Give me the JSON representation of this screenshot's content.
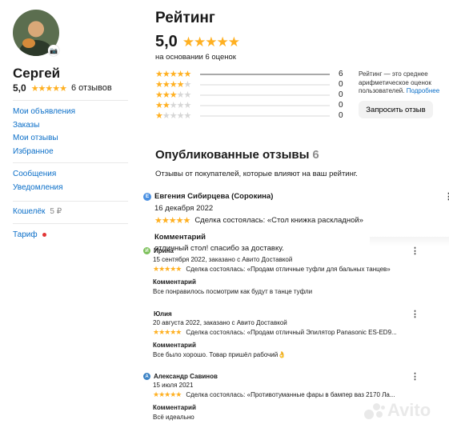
{
  "sidebar": {
    "name": "Сергей",
    "rating": "5,0",
    "stars": "★★★★★",
    "reviews_count": "6 отзывов",
    "nav_group1": [
      "Мои объявления",
      "Заказы",
      "Мои отзывы",
      "Избранное"
    ],
    "nav_group2": [
      "Сообщения",
      "Уведомления"
    ],
    "wallet_label": "Кошелёк",
    "wallet_balance": "5 ₽",
    "tariff": "Тариф",
    "camera_icon": "📷"
  },
  "rating": {
    "title": "Рейтинг",
    "value": "5,0",
    "stars": "★★★★★",
    "based_on": "на основании 6 оценок",
    "distribution": [
      {
        "stars": 5,
        "count": "6",
        "fraction": 1.0
      },
      {
        "stars": 4,
        "count": "0",
        "fraction": 0
      },
      {
        "stars": 3,
        "count": "0",
        "fraction": 0
      },
      {
        "stars": 2,
        "count": "0",
        "fraction": 0
      },
      {
        "stars": 1,
        "count": "0",
        "fraction": 0
      }
    ],
    "info_text": "Рейтинг — это среднее арифметическое оценок пользователей.",
    "info_link": "Подробнее",
    "ask_button": "Запросить отзыв"
  },
  "published": {
    "title": "Опубликованные отзывы",
    "count": "6",
    "description": "Отзывы от покупателей, которые влияют на ваш рейтинг."
  },
  "reviews": [
    {
      "badge": "Е",
      "badge_color": "#4a90e2",
      "name": "Евгения Сибирцева (Сорокина)",
      "date": "16 декабря 2022",
      "stars": "★★★★★",
      "deal": "Сделка состоялась: «Стол книжка раскладной»",
      "comment_title": "Комментарий",
      "comment": "отличный стол! спасибо за доставку.",
      "more": "⋮"
    },
    {
      "badge": "И",
      "badge_color": "#7cc05a",
      "name": "Ирина",
      "date": "15 сентября 2022, заказано с Авито Доставкой",
      "stars": "★★★★★",
      "deal": "Сделка состоялась: «Продам отличные туфли для бальных танцев»",
      "comment_title": "Комментарий",
      "comment": "Все понравилось посмотрим как будут в танце туфли",
      "more": "⋮"
    },
    {
      "badge": "",
      "badge_color": "#ffffff",
      "name": "Юлия",
      "date": "20 августа 2022, заказано с Авито Доставкой",
      "stars": "★★★★★",
      "deal": "Сделка состоялась: «Продам отличный Эпилятор Panasonic ES-ED9...",
      "comment_title": "Комментарий",
      "comment": "Все было хорошо. Товар пришёл рабочий👌",
      "more": "⋮"
    },
    {
      "badge": "А",
      "badge_color": "#3b82c4",
      "name": "Александр Савинов",
      "date": "15 июля 2021",
      "stars": "★★★★★",
      "deal": "Сделка состоялась: «Противотуманные фары в бампер ваз 2170 Ла...",
      "comment_title": "Комментарий",
      "comment": "Всё идеально",
      "more": "⋮"
    }
  ],
  "watermark": "Avito",
  "colors": {
    "star": "#ffb021",
    "link": "#0a6ec8",
    "tariff_dot": "#e23636"
  }
}
